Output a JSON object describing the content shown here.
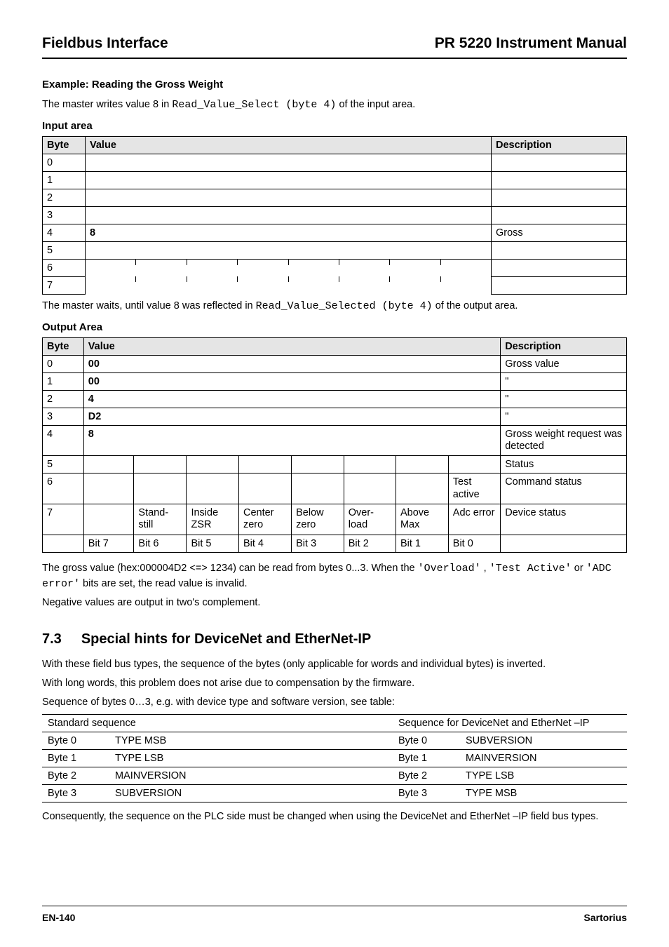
{
  "header": {
    "left": "Fieldbus Interface",
    "right": "PR 5220 Instrument Manual"
  },
  "section": {
    "example_heading": "Example: Reading the Gross Weight",
    "intro_pre": "The master writes value 8 in ",
    "intro_code": "Read_Value_Select (byte 4)",
    "intro_post": " of the input area."
  },
  "input_area": {
    "label": "Input area",
    "col_byte": "Byte",
    "col_value": "Value",
    "col_desc": "Description",
    "rows": [
      {
        "byte": "0",
        "value": "",
        "desc": ""
      },
      {
        "byte": "1",
        "value": "",
        "desc": ""
      },
      {
        "byte": "2",
        "value": "",
        "desc": ""
      },
      {
        "byte": "3",
        "value": "",
        "desc": ""
      },
      {
        "byte": "4",
        "value": "8",
        "desc": "Gross"
      },
      {
        "byte": "5",
        "value": "",
        "desc": ""
      },
      {
        "byte": "6",
        "value": "",
        "desc": ""
      },
      {
        "byte": "7",
        "value": "",
        "desc": ""
      }
    ],
    "row6_sub": [
      "",
      "",
      "",
      "",
      "",
      "",
      "",
      ""
    ],
    "row7_sub": [
      "",
      "",
      "",
      "",
      "",
      "",
      "",
      ""
    ]
  },
  "between": {
    "pre": "The master waits, until value 8 was reflected in ",
    "code": "Read_Value_Selected (byte 4)",
    "post": " of the output area."
  },
  "output_area": {
    "label": "Output Area",
    "col_byte": "Byte",
    "col_value": "Value",
    "col_desc": "Description",
    "rows": [
      {
        "byte": "0",
        "value": "00",
        "desc": "Gross value"
      },
      {
        "byte": "1",
        "value": "00",
        "desc": "\""
      },
      {
        "byte": "2",
        "value": "4",
        "desc": "\""
      },
      {
        "byte": "3",
        "value": "D2",
        "desc": "\""
      },
      {
        "byte": "4",
        "value": "8",
        "desc": "Gross weight request was detected"
      }
    ],
    "sub_rows": {
      "5": {
        "byte": "5",
        "cells": [
          "",
          "",
          "",
          "",
          "",
          "",
          "",
          ""
        ],
        "desc": "Status"
      },
      "6": {
        "byte": "6",
        "cells": [
          "",
          "",
          "",
          "",
          "",
          "",
          "",
          "Test active"
        ],
        "desc": "Command status"
      },
      "7": {
        "byte": "7",
        "cells": [
          "",
          "Stand-still",
          "Inside ZSR",
          "Center zero",
          "Below zero",
          "Over-load",
          "Above Max",
          "Adc error"
        ],
        "desc": "Device status"
      },
      "bits": {
        "byte": "",
        "cells": [
          "Bit 7",
          "Bit 6",
          "Bit 5",
          "Bit 4",
          "Bit 3",
          "Bit 2",
          "Bit 1",
          "Bit 0"
        ],
        "desc": ""
      }
    }
  },
  "notes": {
    "line1_pre": "The gross value (hex:000004D2 <=> 1234) can be read from bytes 0...3. When the ",
    "line1_c1": "'Overload'",
    "line1_mid1": ", ",
    "line1_c2": "'Test Active'",
    "line1_mid2": " or ",
    "line1_c3": "'ADC error'",
    "line1_post": " bits are set, the read value is invalid.",
    "line2": "Negative values are output in two's complement."
  },
  "sec73": {
    "num": "7.3",
    "title": "Special hints for DeviceNet and EtherNet-IP",
    "p1": "With these field bus types, the sequence of the bytes (only applicable for words and individual bytes) is inverted.",
    "p2": "With long words, this problem does not arise due to compensation by the firmware.",
    "p3": "Sequence of bytes 0…3, e.g. with device type and software version, see table:",
    "table": {
      "head_left": "Standard sequence",
      "head_right": "Sequence for DeviceNet and EtherNet –IP",
      "rows": [
        {
          "a": "Byte 0",
          "b": "TYPE MSB",
          "c": "Byte 0",
          "d": "SUBVERSION"
        },
        {
          "a": "Byte 1",
          "b": "TYPE LSB",
          "c": "Byte 1",
          "d": "MAINVERSION"
        },
        {
          "a": "Byte 2",
          "b": "MAINVERSION",
          "c": "Byte 2",
          "d": "TYPE LSB"
        },
        {
          "a": "Byte 3",
          "b": "SUBVERSION",
          "c": "Byte 3",
          "d": "TYPE MSB"
        }
      ]
    },
    "p4": "Consequently, the sequence on the PLC side must be changed when using the DeviceNet and EtherNet –IP field bus types."
  },
  "footer": {
    "left": "EN-140",
    "right": "Sartorius"
  }
}
